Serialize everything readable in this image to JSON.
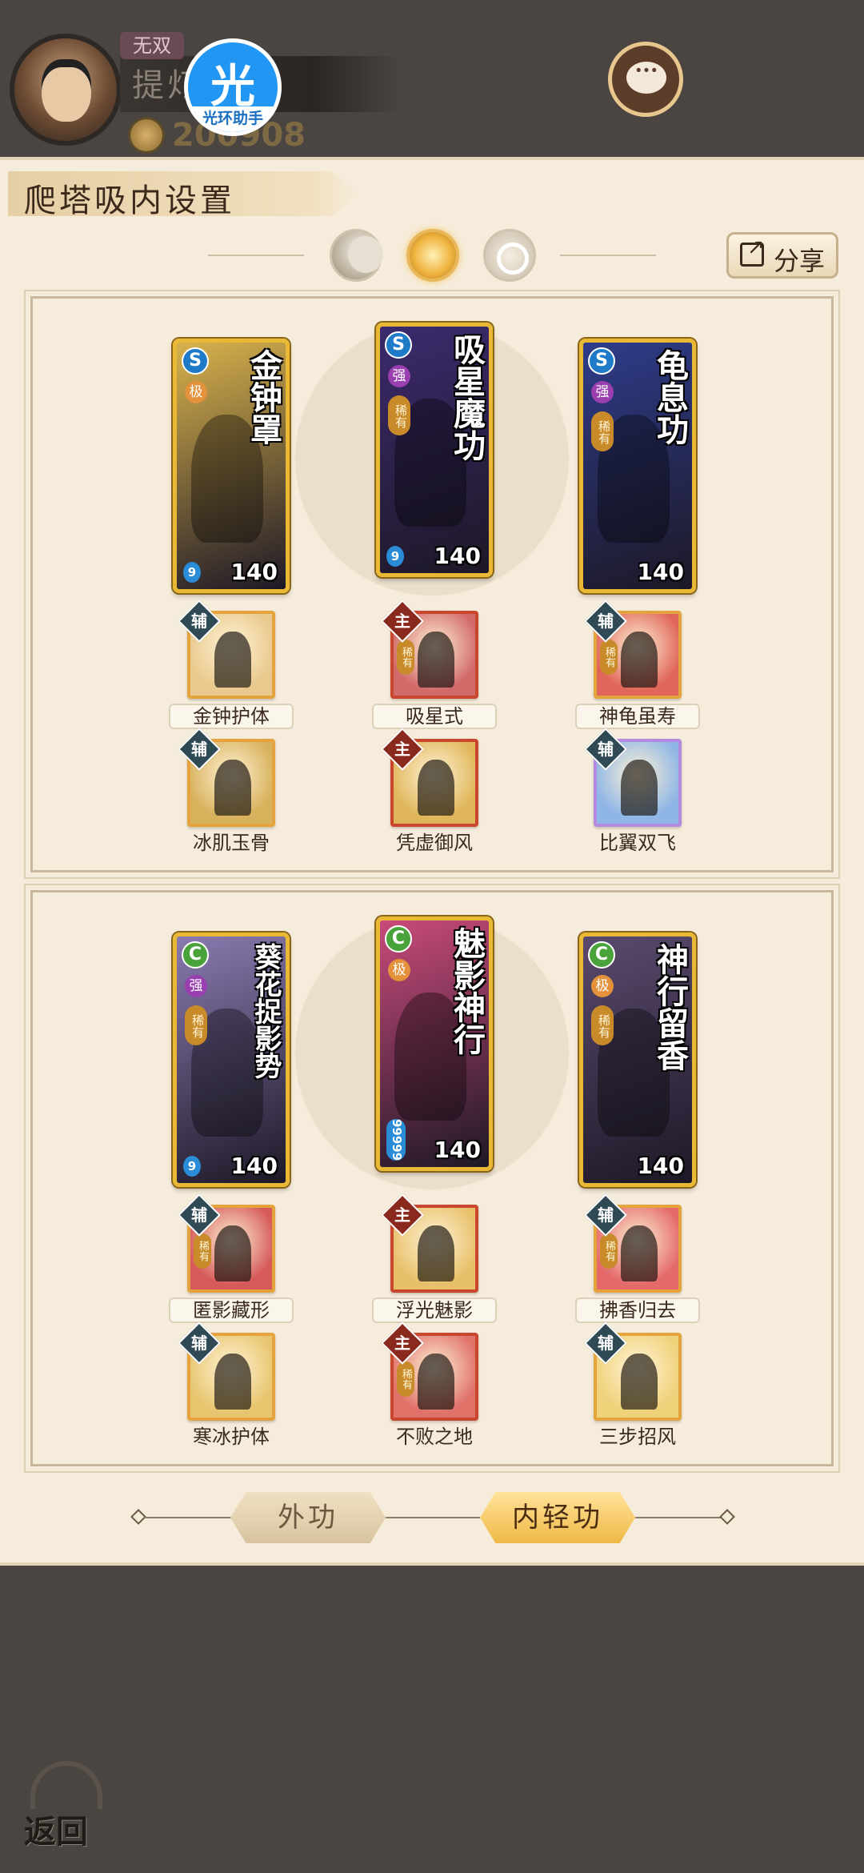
{
  "player": {
    "rank_tag": "无双",
    "name": "提灯",
    "power": "200908"
  },
  "helper_badge": {
    "glyph": "光",
    "label": "光环助手"
  },
  "panel": {
    "title": "爬塔吸内设置",
    "share_label": "分享",
    "orbs": [
      "moon-icon",
      "sun-icon",
      "ring-icon"
    ]
  },
  "sections": [
    {
      "cards": [
        {
          "title": "金钟罩",
          "school": "S",
          "tier": "极",
          "rare": "",
          "level": "140",
          "drops": "9",
          "color": "#d8b24c"
        },
        {
          "title": "吸星魔功",
          "school": "S",
          "tier": "强",
          "rare": "稀有",
          "level": "140",
          "drops": "9",
          "color": "#3c2a6e"
        },
        {
          "title": "龟息功",
          "school": "S",
          "tier": "强",
          "rare": "稀有",
          "level": "140",
          "drops": "",
          "color": "#2e3c8a"
        }
      ],
      "skills_row1": [
        {
          "name": "金钟护体",
          "role": "辅",
          "rare": "",
          "color": "#e9c98d"
        },
        {
          "name": "吸星式",
          "role": "主",
          "rare": "稀有",
          "color": "#d26a6a"
        },
        {
          "name": "神龟虽寿",
          "role": "辅",
          "rare": "稀有",
          "color": "#e0655a"
        }
      ],
      "skills_row2": [
        {
          "name": "冰肌玉骨",
          "role": "辅",
          "rare": "",
          "color": "#d8b15c"
        },
        {
          "name": "凭虚御风",
          "role": "主",
          "rare": "",
          "color": "#e0b65a"
        },
        {
          "name": "比翼双飞",
          "role": "辅",
          "rare": "",
          "color": "#8fb6e6"
        }
      ]
    },
    {
      "cards": [
        {
          "title": "葵花捉影势",
          "school": "C",
          "tier": "强",
          "rare": "稀有",
          "level": "140",
          "drops": "9",
          "color": "#8a7ab0"
        },
        {
          "title": "魅影神行",
          "school": "C",
          "tier": "极",
          "rare": "",
          "level": "140",
          "drops": "99999",
          "color": "#c84a7a"
        },
        {
          "title": "神行留香",
          "school": "C",
          "tier": "极",
          "rare": "稀有",
          "level": "140",
          "drops": "",
          "color": "#5a4a6e"
        }
      ],
      "skills_row1": [
        {
          "name": "匿影藏形",
          "role": "辅",
          "rare": "稀有",
          "color": "#d65a5a"
        },
        {
          "name": "浮光魅影",
          "role": "主",
          "rare": "",
          "color": "#e8c06a"
        },
        {
          "name": "拂香归去",
          "role": "辅",
          "rare": "稀有",
          "color": "#e46a6a"
        }
      ],
      "skills_row2": [
        {
          "name": "寒冰护体",
          "role": "辅",
          "rare": "",
          "color": "#e8c670"
        },
        {
          "name": "不败之地",
          "role": "主",
          "rare": "稀有",
          "color": "#e0726a"
        },
        {
          "name": "三步招风",
          "role": "辅",
          "rare": "",
          "color": "#f0d27a"
        }
      ]
    }
  ],
  "tabs": {
    "outer": "外功",
    "inner": "内轻功",
    "active": "inner"
  },
  "back_label": "返回"
}
